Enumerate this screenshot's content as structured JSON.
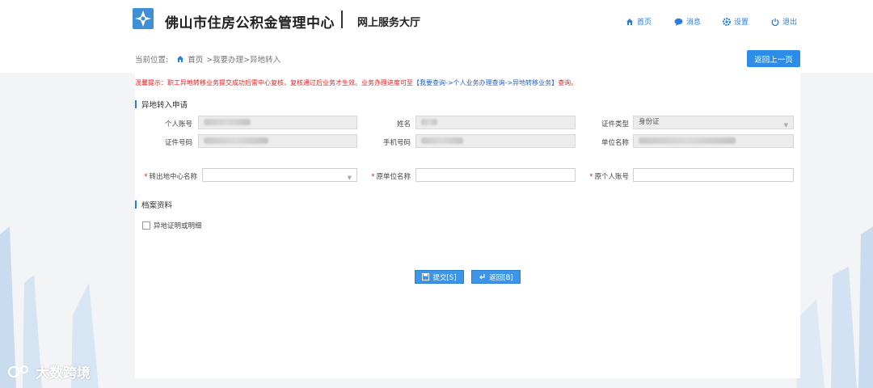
{
  "header": {
    "org_name": "佛山市住房公积金管理中心",
    "sub_title": "网上服务大厅",
    "nav": [
      {
        "label": "首页",
        "icon": "home-icon"
      },
      {
        "label": "消息",
        "icon": "message-icon"
      },
      {
        "label": "设置",
        "icon": "gear-icon"
      },
      {
        "label": "退出",
        "icon": "power-icon"
      }
    ]
  },
  "breadcrumb": {
    "prefix": "当前位置:",
    "home": "首页",
    "path": " >我要办理>异地转入"
  },
  "back_top_label": "返回上一页",
  "tip": {
    "text": "温馨提示：职工异地转移业务提交成功后需中心复核，复核通过后业务才生效。业务办理进度可至",
    "link": "【我要查询->个人业务办理查询->异地转移业务】",
    "suffix": "查询。"
  },
  "section_apply": {
    "title": "异地转入申请",
    "labels": {
      "personal_account": "个人账号",
      "name": "姓名",
      "id_type": "证件类型",
      "id_number": "证件号码",
      "phone": "手机号码",
      "employer": "单位名称",
      "out_center": "转出地中心名称",
      "orig_employer": "原单位名称",
      "orig_account": "原个人账号"
    },
    "id_type_value": "身份证",
    "required_mark": "*"
  },
  "section_archive": {
    "title": "档案资料",
    "checkbox_label": "异地证明或明细"
  },
  "buttons": {
    "submit": "提交[S]",
    "back": "返回[B]"
  },
  "watermark": "大数跨境",
  "colors": {
    "accent": "#2d8ce8",
    "warning": "#e02020"
  }
}
